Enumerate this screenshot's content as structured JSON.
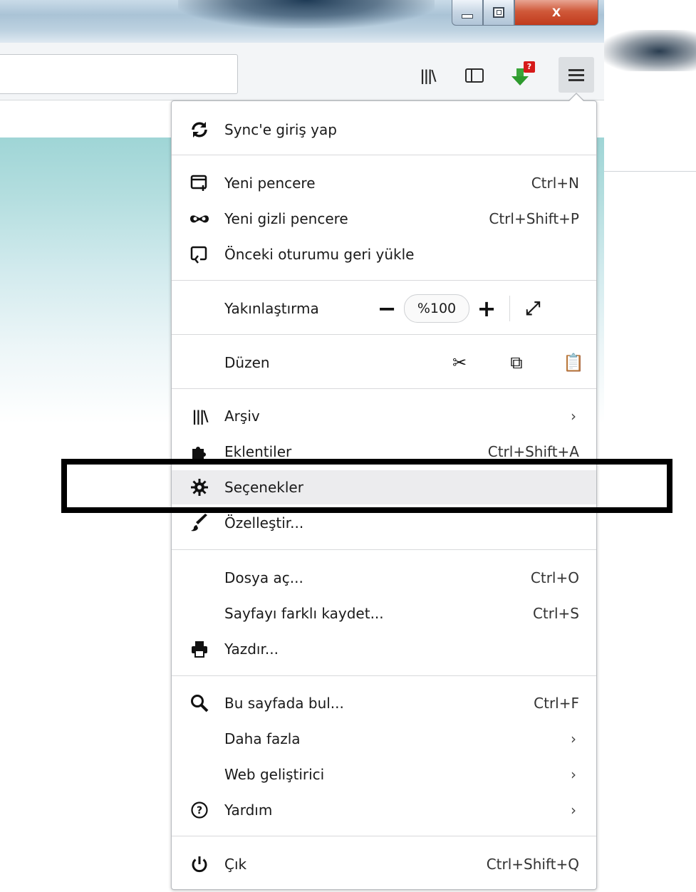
{
  "menu": {
    "sync": {
      "label": "Sync'e giriş yap",
      "icon": "sync-icon"
    },
    "new_window": {
      "label": "Yeni pencere",
      "shortcut": "Ctrl+N",
      "icon": "new-window-icon"
    },
    "private_window": {
      "label": "Yeni gizli pencere",
      "shortcut": "Ctrl+Shift+P",
      "icon": "mask-icon"
    },
    "restore_session": {
      "label": "Önceki oturumu geri yükle",
      "icon": "restore-icon"
    },
    "zoom": {
      "label": "Yakınlaştırma",
      "value": "%100",
      "minus": "−",
      "plus": "+",
      "fullscreen": "⤢"
    },
    "edit": {
      "label": "Düzen",
      "cut": "✂",
      "copy": "⧉",
      "paste": "📋"
    },
    "library": {
      "label": "Arşiv",
      "chevron": "›",
      "icon": "library-icon"
    },
    "addons": {
      "label": "Eklentiler",
      "shortcut": "Ctrl+Shift+A",
      "icon": "puzzle-icon"
    },
    "options": {
      "label": "Seçenekler",
      "icon": "gear-icon"
    },
    "customize": {
      "label": "Özelleştir...",
      "icon": "paintbrush-icon"
    },
    "open_file": {
      "label": "Dosya aç...",
      "shortcut": "Ctrl+O"
    },
    "save_page": {
      "label": "Sayfayı farklı kaydet...",
      "shortcut": "Ctrl+S"
    },
    "print": {
      "label": "Yazdır...",
      "icon": "printer-icon"
    },
    "find": {
      "label": "Bu sayfada bul...",
      "shortcut": "Ctrl+F",
      "icon": "search-icon"
    },
    "more": {
      "label": "Daha fazla",
      "chevron": "›"
    },
    "web_dev": {
      "label": "Web geliştirici",
      "chevron": "›"
    },
    "help": {
      "label": "Yardım",
      "chevron": "›",
      "icon": "help-icon"
    },
    "quit": {
      "label": "Çık",
      "shortcut": "Ctrl+Shift+Q",
      "icon": "power-icon"
    }
  },
  "toolbar": {
    "download_badge": "?",
    "library_glyph": "|||\\"
  },
  "window_controls": {
    "close": "X"
  },
  "colors": {
    "highlight_row": "#ececee",
    "frame": "#000000",
    "close_button": "#c94b2c"
  }
}
